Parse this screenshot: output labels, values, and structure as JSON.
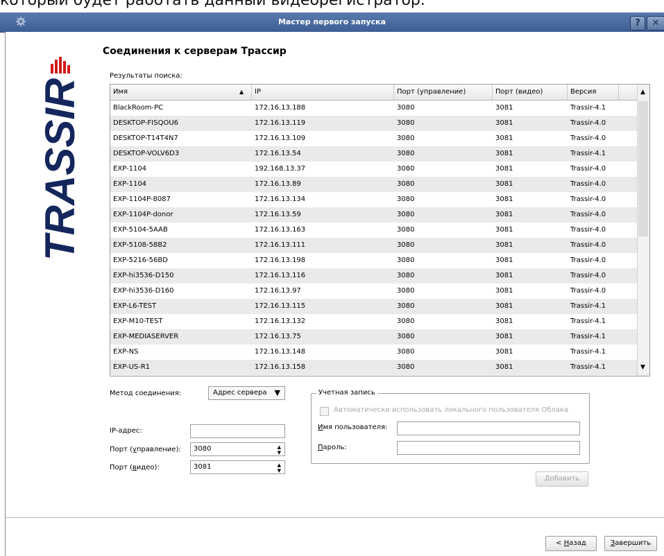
{
  "top_text": "который будет работать данный видеорегистратор.",
  "window": {
    "title": "Мастер первого запуска",
    "help_label": "?",
    "close_label": "✕"
  },
  "brand": {
    "logo_text": "TRASSIR"
  },
  "page": {
    "heading": "Соединения к серверам Трассир"
  },
  "search": {
    "results_label": "Результаты поиска:",
    "columns": [
      "Имя",
      "IP",
      "Порт (управление)",
      "Порт (видео)",
      "Версия"
    ],
    "sort_indicator": "▲",
    "rows": [
      [
        "BlackRoom-PC",
        "172.16.13.188",
        "3080",
        "3081",
        "Trassir-4.1"
      ],
      [
        "DESKTOP-FISQOU6",
        "172.16.13.119",
        "3080",
        "3081",
        "Trassir-4.0"
      ],
      [
        "DESKTOP-T14T4N7",
        "172.16.13.109",
        "3080",
        "3081",
        "Trassir-4.0"
      ],
      [
        "DESKTOP-VOLV6D3",
        "172.16.13.54",
        "3080",
        "3081",
        "Trassir-4.1"
      ],
      [
        "EXP-1104",
        "192.168.13.37",
        "3080",
        "3081",
        "Trassir-4.0"
      ],
      [
        "EXP-1104",
        "172.16.13.89",
        "3080",
        "3081",
        "Trassir-4.0"
      ],
      [
        "EXP-1104P-8087",
        "172.16.13.134",
        "3080",
        "3081",
        "Trassir-4.0"
      ],
      [
        "EXP-1104P-donor",
        "172.16.13.59",
        "3080",
        "3081",
        "Trassir-4.0"
      ],
      [
        "EXP-5104-5AAB",
        "172.16.13.163",
        "3080",
        "3081",
        "Trassir-4.0"
      ],
      [
        "EXP-5108-58B2",
        "172.16.13.111",
        "3080",
        "3081",
        "Trassir-4.0"
      ],
      [
        "EXP-5216-56BD",
        "172.16.13.198",
        "3080",
        "3081",
        "Trassir-4.0"
      ],
      [
        "EXP-hi3536-D150",
        "172.16.13.116",
        "3080",
        "3081",
        "Trassir-4.0"
      ],
      [
        "EXP-hi3536-D160",
        "172.16.13.97",
        "3080",
        "3081",
        "Trassir-4.0"
      ],
      [
        "EXP-L6-TEST",
        "172.16.13.115",
        "3080",
        "3081",
        "Trassir-4.1"
      ],
      [
        "EXP-M10-TEST",
        "172.16.13.132",
        "3080",
        "3081",
        "Trassir-4.1"
      ],
      [
        "EXP-MEDIASERVER",
        "172.16.13.75",
        "3080",
        "3081",
        "Trassir-4.1"
      ],
      [
        "EXP-NS",
        "172.16.13.148",
        "3080",
        "3081",
        "Trassir-4.1"
      ],
      [
        "EXP-US-R1",
        "172.16.13.158",
        "3080",
        "3081",
        "Trassir-4.1"
      ]
    ]
  },
  "connection": {
    "method_label": "Метод соединения:",
    "method_value": "Адрес сервера",
    "ip_label": "IP-адрес:",
    "ip_value": "",
    "control_port_label_pre": "Порт (",
    "control_port_label_u": "у",
    "control_port_label_post": "правление):",
    "control_port_value": "3080",
    "video_port_label_pre": "Порт (",
    "video_port_label_u": "в",
    "video_port_label_post": "идео):",
    "video_port_value": "3081"
  },
  "account": {
    "group_title": "Учетная запись",
    "auto_label": "Автоматически использовать локального пользователя Облака",
    "username_label_u": "И",
    "username_label_rest": "мя пользователя:",
    "username_value": "",
    "password_label_u": "П",
    "password_label_rest": "ароль:",
    "password_value": "",
    "add_u": "Д",
    "add_rest": "обавить"
  },
  "footer": {
    "back_pre": "< ",
    "back_u": "Н",
    "back_rest": "азад",
    "finish_u": "З",
    "finish_rest": "авершить"
  },
  "colors": {
    "titlebar": "#4a6aa0",
    "logo": "#14265c",
    "logo_accent": "#d21a1a"
  }
}
